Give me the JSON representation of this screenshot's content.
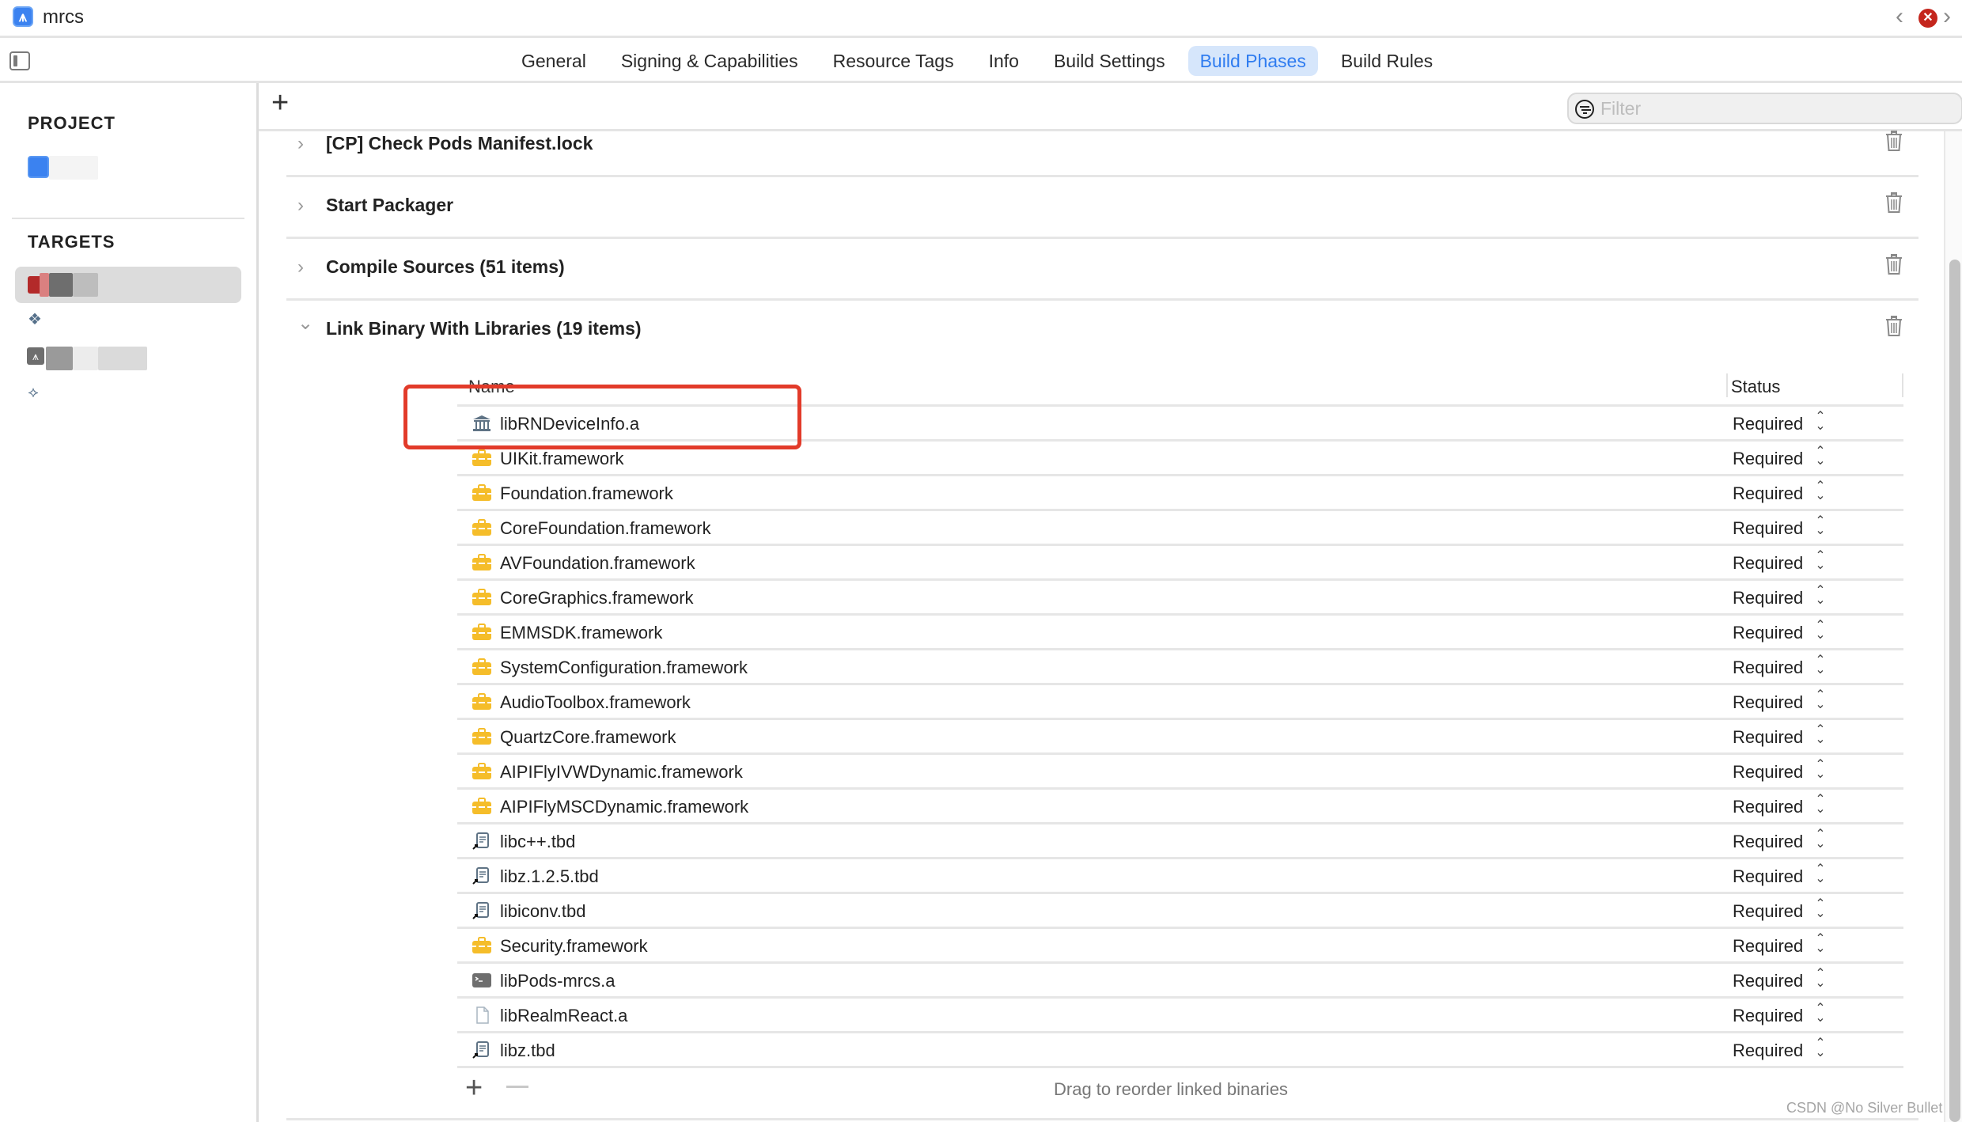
{
  "window": {
    "title": "mrcs",
    "app_icon": "xcode-project-icon",
    "nav_back": "‹",
    "nav_forward": "›",
    "error_badge": "✕"
  },
  "tabs": [
    {
      "label": "General",
      "active": false
    },
    {
      "label": "Signing & Capabilities",
      "active": false
    },
    {
      "label": "Resource Tags",
      "active": false
    },
    {
      "label": "Info",
      "active": false
    },
    {
      "label": "Build Settings",
      "active": false
    },
    {
      "label": "Build Phases",
      "active": true
    },
    {
      "label": "Build Rules",
      "active": false
    }
  ],
  "sidebar": {
    "project_heading": "PROJECT",
    "targets_heading": "TARGETS"
  },
  "toolbar": {
    "add_label": "+",
    "filter_placeholder": "Filter",
    "filter_value": ""
  },
  "phases": [
    {
      "title": "[CP] Check Pods Manifest.lock",
      "expanded": false
    },
    {
      "title": "Start Packager",
      "expanded": false
    },
    {
      "title": "Compile Sources (51 items)",
      "expanded": false
    },
    {
      "title": "Link Binary With Libraries (19 items)",
      "expanded": true
    }
  ],
  "libraries": {
    "columns": {
      "name": "Name",
      "status": "Status"
    },
    "rows": [
      {
        "name": "libRNDeviceInfo.a",
        "icon": "library-icon",
        "status": "Required",
        "highlighted": true
      },
      {
        "name": "UIKit.framework",
        "icon": "framework-icon",
        "status": "Required"
      },
      {
        "name": "Foundation.framework",
        "icon": "framework-icon",
        "status": "Required"
      },
      {
        "name": "CoreFoundation.framework",
        "icon": "framework-icon",
        "status": "Required"
      },
      {
        "name": "AVFoundation.framework",
        "icon": "framework-icon",
        "status": "Required"
      },
      {
        "name": "CoreGraphics.framework",
        "icon": "framework-icon",
        "status": "Required"
      },
      {
        "name": "EMMSDK.framework",
        "icon": "framework-icon",
        "status": "Required"
      },
      {
        "name": "SystemConfiguration.framework",
        "icon": "framework-icon",
        "status": "Required"
      },
      {
        "name": "AudioToolbox.framework",
        "icon": "framework-icon",
        "status": "Required"
      },
      {
        "name": "QuartzCore.framework",
        "icon": "framework-icon",
        "status": "Required"
      },
      {
        "name": "AIPIFlyIVWDynamic.framework",
        "icon": "framework-icon",
        "status": "Required"
      },
      {
        "name": "AIPIFlyMSCDynamic.framework",
        "icon": "framework-icon",
        "status": "Required"
      },
      {
        "name": "libc++.tbd",
        "icon": "tbd-alias-icon",
        "status": "Required"
      },
      {
        "name": "libz.1.2.5.tbd",
        "icon": "tbd-alias-icon",
        "status": "Required"
      },
      {
        "name": "libiconv.tbd",
        "icon": "tbd-alias-icon",
        "status": "Required"
      },
      {
        "name": "Security.framework",
        "icon": "framework-icon",
        "status": "Required"
      },
      {
        "name": "libPods-mrcs.a",
        "icon": "terminal-lib-icon",
        "status": "Required"
      },
      {
        "name": "libRealmReact.a",
        "icon": "blank-file-icon",
        "status": "Required"
      },
      {
        "name": "libz.tbd",
        "icon": "tbd-alias-icon",
        "status": "Required"
      }
    ],
    "add_label": "+",
    "footer_hint": "Drag to reorder linked binaries"
  },
  "colors": {
    "accent": "#2f7cf0",
    "active_tab_bg": "#d6e6fb",
    "framework_yellow": "#f5bd2a",
    "annotation_red": "#e23b2a",
    "error_red": "#c4261d"
  },
  "watermark": "CSDN @No Silver Bullet"
}
